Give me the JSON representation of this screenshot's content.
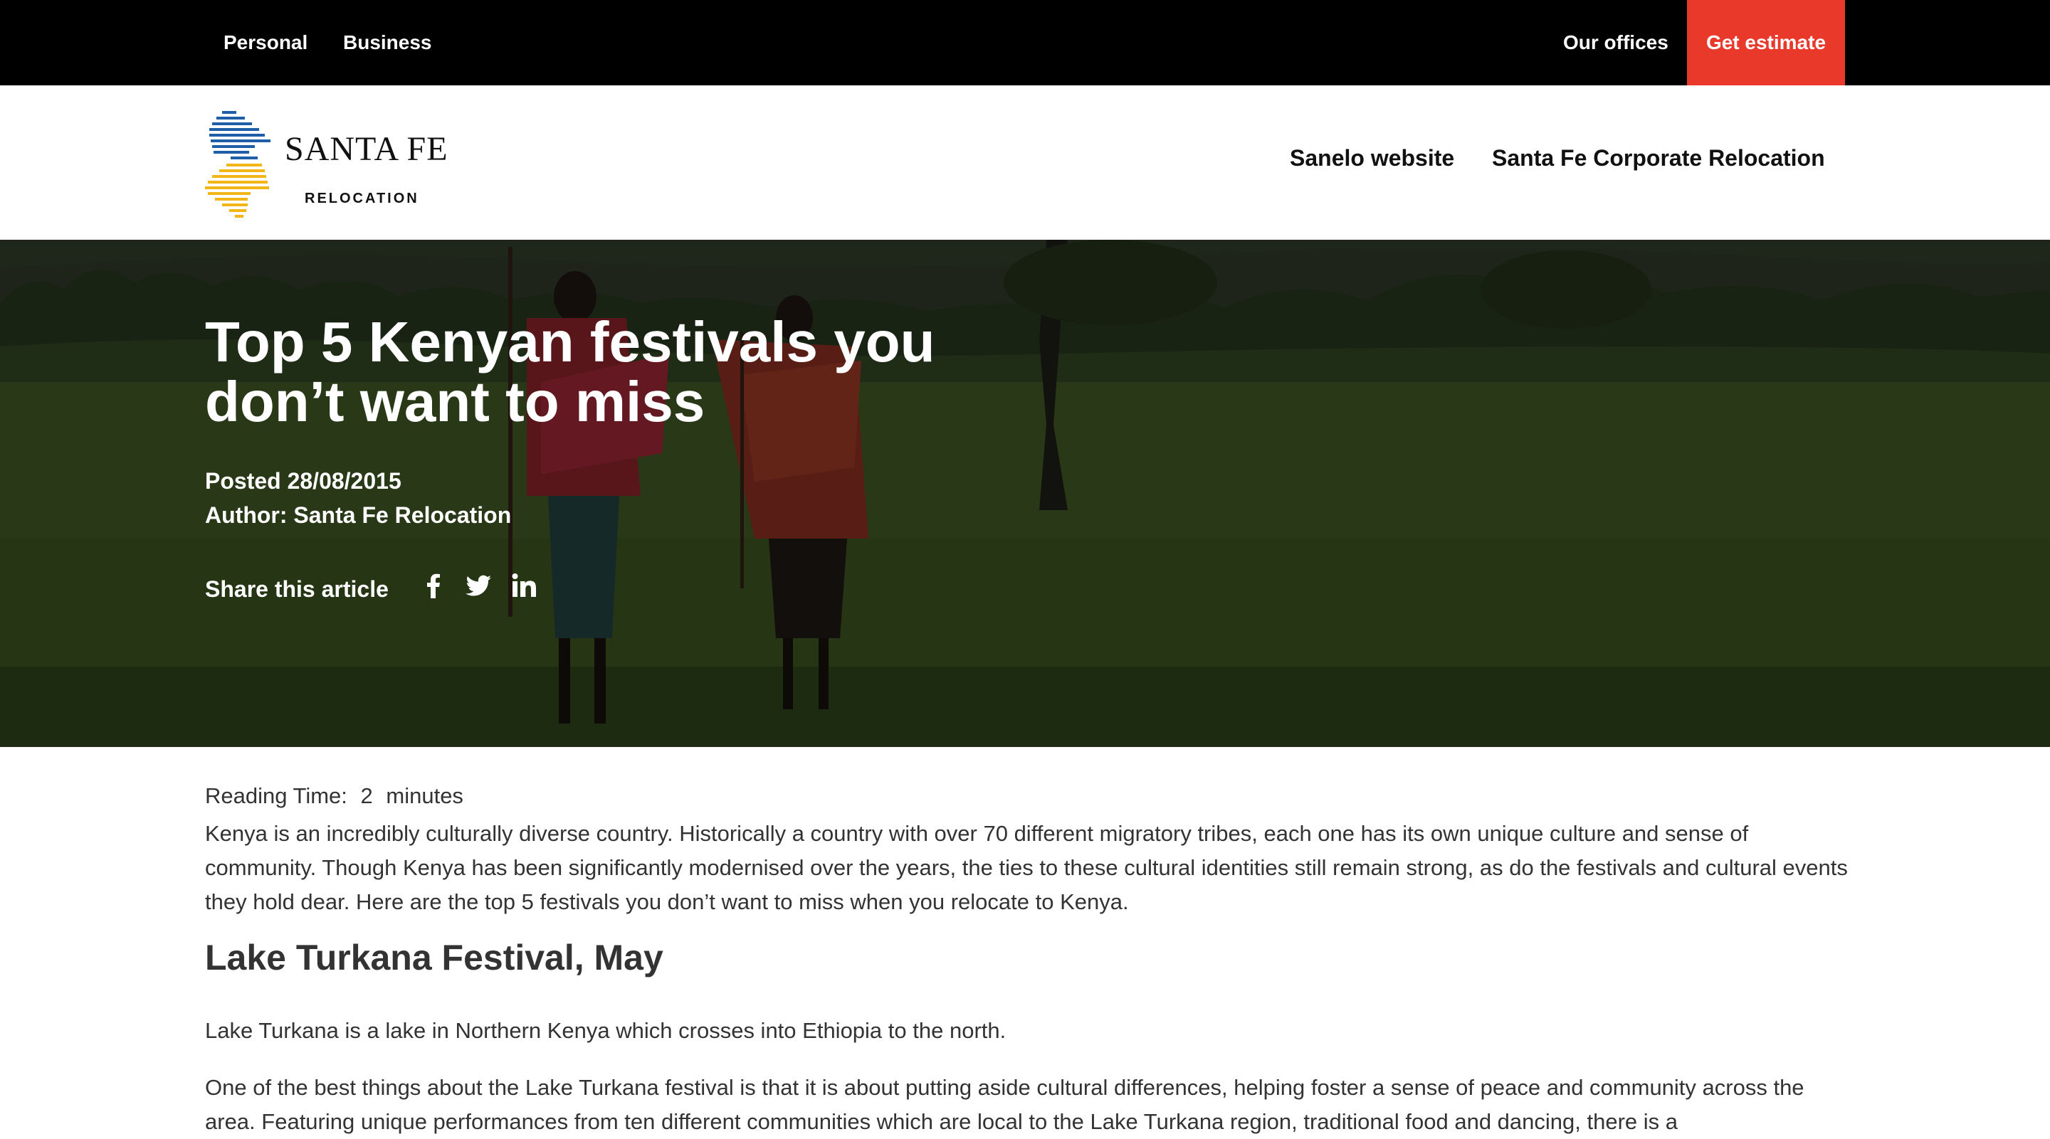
{
  "topbar": {
    "personal": "Personal",
    "business": "Business",
    "offices": "Our offices",
    "estimate": "Get estimate",
    "accent_color": "#e8392b"
  },
  "header": {
    "logo": {
      "name": "SANTA FE",
      "sub": "RELOCATION"
    },
    "nav": {
      "sanelo": "Sanelo website",
      "corporate": "Santa Fe Corporate Relocation"
    }
  },
  "hero": {
    "title": "Top 5 Kenyan festivals you don’t want to miss",
    "posted": "Posted 28/08/2015",
    "author": "Author: Santa Fe Relocation",
    "share_label": "Share this article",
    "share_icons": [
      "facebook-icon",
      "twitter-icon",
      "linkedin-icon"
    ]
  },
  "article": {
    "reading_label": "Reading Time:",
    "reading_value": "2",
    "reading_unit": "minutes",
    "intro": "Kenya is an incredibly culturally diverse country. Historically a country with over 70 different migratory tribes, each one has its own unique culture and sense of community. Though Kenya has been significantly modernised over the years, the ties to these cultural identities still remain strong, as do the festivals and cultural events they hold dear. Here are the top 5 festivals you don’t want to miss when you relocate to Kenya.",
    "section_title": "Lake Turkana Festival, May",
    "para1": "Lake Turkana is a lake in Northern Kenya which crosses into Ethiopia to the north.",
    "para2": "One of the best things about the Lake Turkana festival is that it is about putting aside cultural differences, helping foster a sense of peace and community across the area. Featuring unique performances from ten different communities which are local to the Lake Turkana region, traditional food and dancing, there is a"
  }
}
